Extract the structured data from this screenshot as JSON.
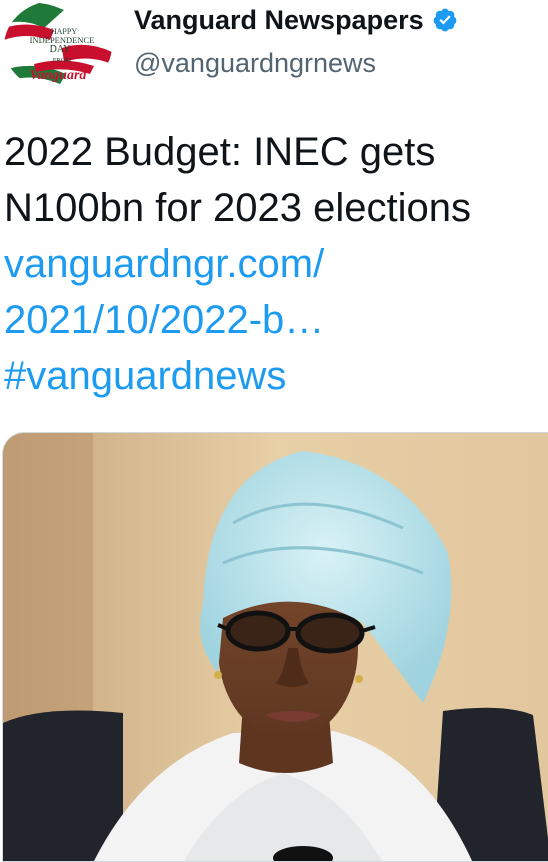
{
  "account": {
    "display_name": "Vanguard Newspapers",
    "handle": "@vanguardngrnews",
    "avatar_lines": [
      "HAPPY",
      "INDEPENDENCE",
      "DAY",
      "FROM",
      "Vanguard"
    ],
    "verified_icon": "verified-badge-icon"
  },
  "tweet": {
    "text_line_1": "2022 Budget: INEC gets",
    "text_line_2": "N100bn for 2023 elections",
    "link_line_1": "vanguardngr.com/",
    "link_line_2": "2021/10/2022-b…",
    "hashtag": "#vanguardnews"
  },
  "colors": {
    "link": "#1d9bf0",
    "verified": "#1d9bf0",
    "handle": "#536471",
    "text": "#0f1419"
  }
}
